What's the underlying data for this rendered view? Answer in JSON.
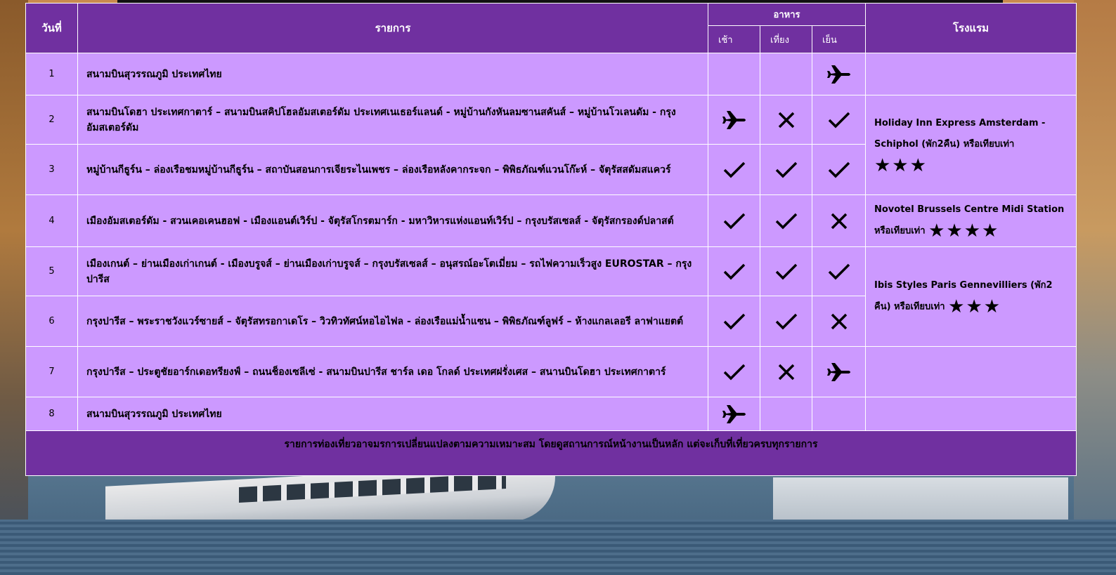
{
  "table": {
    "headers": {
      "day": "วันที่",
      "program": "รายการ",
      "meals": "อาหาร",
      "breakfast": "เช้า",
      "lunch": "เที่ยง",
      "dinner": "เย็น",
      "hotel": "โรงแรม"
    },
    "rows": [
      {
        "day": "1",
        "program": "สนามบินสุวรรณภูมิ ประเทศไทย",
        "meals": [
          "none",
          "none",
          "plane"
        ]
      },
      {
        "day": "2",
        "program": "สนามบินโดฮา ประเทศกาตาร์ – สนามบินสคิปโฮลอัมสเตอร์ดัม ประเทศเนเธอร์แลนด์ - หมู่บ้านกังหันลมซานสคันส์ – หมู่บ้านโวเลนดัม - กรุงอัมสเตอร์ดัม",
        "meals": [
          "plane",
          "cross",
          "check"
        ]
      },
      {
        "day": "3",
        "program": "หมู่บ้านกีธูร์น – ล่องเรือชมหมู่บ้านกีธูร์น – สถาบันสอนการเจียระไนเพชร – ล่องเรือหลังคากระจก – พิพิธภัณฑ์แวนโก๊ะห์ – จัตุรัสสดัมสแควร์",
        "meals": [
          "check",
          "check",
          "check"
        ]
      },
      {
        "day": "4",
        "program": "เมืองอัมสเตอร์ดัม - สวนเคอเคนฮอฟ -  เมืองแอนต์เวิร์ป - จัตุรัสโกรตมาร์ก - มหาวิหารแห่งแอนท์เวิร์ป – กรุงบรัสเซลส์ - จัตุรัสกรองด์ปลาสต์",
        "meals": [
          "check",
          "check",
          "cross"
        ]
      },
      {
        "day": "5",
        "program": "เมืองเกนต์ – ย่านเมืองเก่าเกนต์ - เมืองบรูจส์ – ย่านเมืองเก่าบรูจส์ – กรุงบรัสเซลส์ – อนุสรณ์อะโตเมี่ยม – รถไฟความเร็วสูง EUROSTAR –  กรุงปารีส",
        "meals": [
          "check",
          "check",
          "check"
        ]
      },
      {
        "day": "6",
        "program": "กรุงปารีส – พระราชวังแวร์ซายส์ – จัตุรัสทรอกาเดโร – วิวทิวทัศน์หอไอไฟล  - ล่องเรือแม่น้ำแซน – พิพิธภัณฑ์ลูฟร์ – ห้างแกลเลอรี ลาฟาแยตต์",
        "meals": [
          "check",
          "check",
          "cross"
        ]
      },
      {
        "day": "7",
        "program": "กรุงปารีส – ประตูชัยอาร์กเดอทรียงฟ์ – ถนนช็องเซลีเซ่ - สนามบินปารีส ชาร์ล เดอ โกลด์ ประเทศฝรั่งเศส – สนานบินโดฮา ประเทศกาตาร์",
        "meals": [
          "check",
          "cross",
          "plane"
        ]
      },
      {
        "day": "8",
        "program": "สนามบินสุวรรณภูมิ ประเทศไทย",
        "meals": [
          "plane",
          "none",
          "none"
        ]
      }
    ],
    "hotels": [
      {
        "text": "Holiday Inn Express Amsterdam - Schiphol (พัก2คืน) หรือเทียบเท่า",
        "stars": "★★★"
      },
      {
        "text": "Novotel Brussels Centre Midi Station หรือเทียบเท่า",
        "stars": "★★★★"
      },
      {
        "text": "Ibis Styles Paris Gennevilliers (พัก2 คืน) หรือเทียบเท่า",
        "stars": "★★★"
      }
    ],
    "note": "รายการท่องเที่ยวอาจมรการเปลี่ยนแปลงตามความเหมาะสม โดยดูสถานการณ์หน้างานเป็นหลัก แต่จะเก็บที่เที่ยวครบทุกรายการ"
  },
  "colors": {
    "header": "#7030a0",
    "row": "#cc99ff",
    "border": "#ffffff"
  },
  "icons": {
    "plane": "plane-icon",
    "check": "check-icon",
    "cross": "cross-icon"
  }
}
